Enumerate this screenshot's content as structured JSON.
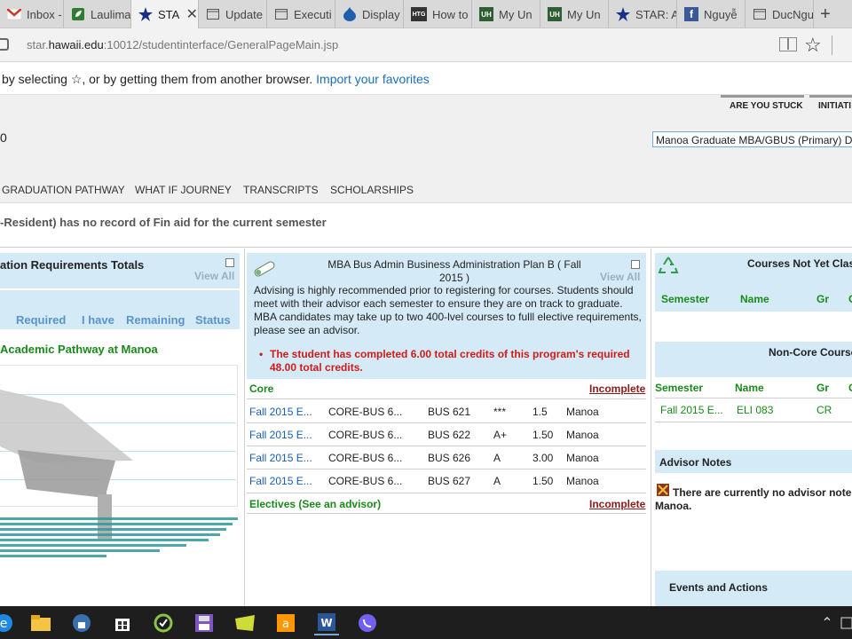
{
  "tabs": [
    {
      "label": "Inbox -",
      "icon": "gmail-icon"
    },
    {
      "label": "Laulima",
      "icon": "laulima-icon"
    },
    {
      "label": "STA",
      "icon": "star-icon",
      "active": true
    },
    {
      "label": "Update",
      "icon": "page-icon"
    },
    {
      "label": "Executi",
      "icon": "page-icon"
    },
    {
      "label": "Display",
      "icon": "drupal-icon"
    },
    {
      "label": "How to",
      "icon": "htg-icon",
      "badge": "HTG"
    },
    {
      "label": "My Un",
      "icon": "uh-icon",
      "badge": "UH"
    },
    {
      "label": "My Un",
      "icon": "uh-icon",
      "badge": "UH"
    },
    {
      "label": "STAR: A",
      "icon": "star-icon"
    },
    {
      "label": "Nguyễ",
      "icon": "facebook-icon"
    },
    {
      "label": "DucNgu",
      "icon": "page-icon"
    }
  ],
  "address": {
    "url_prefix": "star.",
    "url_domain": "hawaii.edu",
    "url_rest": ":10012/studentinterface/GeneralPageMain.jsp"
  },
  "favorites_bar": {
    "text": "by selecting ☆, or by getting them from another browser.",
    "link": "Import your favorites"
  },
  "header": {
    "stuck_label": "ARE YOU STUCK",
    "initiate_label": "INITIATI",
    "id_fragment": "0",
    "program_select": "Manoa Graduate MBA/GBUS (Primary) D"
  },
  "nav": [
    "GRADUATION PATHWAY",
    "WHAT IF JOURNEY",
    "TRANSCRIPTS",
    "SCHOLARSHIPS"
  ],
  "notice": "-Resident) has no record of Fin aid for the current semester",
  "left_panel": {
    "title": "ation Requirements Totals",
    "view_all": "View All",
    "columns": [
      "Required",
      "I have",
      "Remaining",
      "Status"
    ],
    "subtitle": "Academic Pathway at Manoa"
  },
  "middle_panel": {
    "title": "MBA Bus Admin Business Administration Plan B ( Fall 2015 )",
    "view_all": "View All",
    "description": "Advising is highly recommended prior to registering for courses. Students should meet with their advisor each semester to ensure they are on track to graduate. MBA candidates may take up to two 400-lvel courses to fulll elective requirements, please see an advisor.",
    "credits_note": "The student has completed 6.00 total credits of this program's required 48.00 total credits.",
    "core_label": "Core",
    "core_status": "Incomplete",
    "courses": [
      {
        "term": "Fall 2015 E...",
        "req": "CORE-BUS 6...",
        "course": "BUS 621",
        "grade": "***",
        "credits": "1.5",
        "campus": "Manoa"
      },
      {
        "term": "Fall 2015 E...",
        "req": "CORE-BUS 6...",
        "course": "BUS 622",
        "grade": "A+",
        "credits": "1.50",
        "campus": "Manoa"
      },
      {
        "term": "Fall 2015 E...",
        "req": "CORE-BUS 6...",
        "course": "BUS 626",
        "grade": "A",
        "credits": "3.00",
        "campus": "Manoa"
      },
      {
        "term": "Fall 2015 E...",
        "req": "CORE-BUS 6...",
        "course": "BUS 627",
        "grade": "A",
        "credits": "1.50",
        "campus": "Manoa"
      }
    ],
    "electives_label": "Electives (See an advisor)",
    "electives_status": "Incomplete"
  },
  "right_panel": {
    "not_counted_title": "Courses Not Yet Clas",
    "columns": [
      "Semester",
      "Name",
      "Gr",
      "C"
    ],
    "noncore_title": "Non-Core Course",
    "noncore_columns": [
      "Semester",
      "Name",
      "Gr",
      "C"
    ],
    "noncore_row": {
      "semester": "Fall 2015 E...",
      "name": "ELI 083",
      "grade": "CR"
    },
    "advisor_title": "Advisor Notes",
    "advisor_text_1": "There are currently no advisor notes",
    "advisor_text_2": "Manoa.",
    "events_title": "Events and Actions"
  },
  "colors": {
    "panel_bg": "#d4ebf7",
    "link_blue": "#1a5fb4",
    "green": "#1a8a1a",
    "red": "#d21a1a"
  }
}
